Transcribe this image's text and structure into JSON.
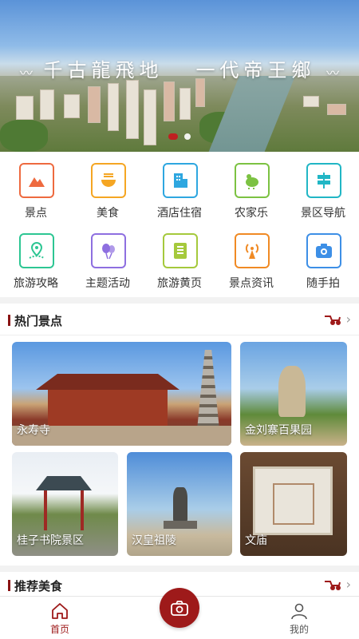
{
  "banner": {
    "title_left": "千古龍飛地",
    "title_right": "一代帝王鄉",
    "slide_count": 2,
    "active_slide": 0
  },
  "categories": [
    {
      "label": "景点",
      "icon": "mountain-icon",
      "color": "#ee6a3f"
    },
    {
      "label": "美食",
      "icon": "noodle-bowl-icon",
      "color": "#f5a623"
    },
    {
      "label": "酒店住宿",
      "icon": "hotel-building-icon",
      "color": "#2ea7e0"
    },
    {
      "label": "农家乐",
      "icon": "chicken-icon",
      "color": "#7cc242"
    },
    {
      "label": "景区导航",
      "icon": "signpost-icon",
      "color": "#21b6c5"
    },
    {
      "label": "旅游攻略",
      "icon": "map-pin-route-icon",
      "color": "#2dc693"
    },
    {
      "label": "主题活动",
      "icon": "balloons-icon",
      "color": "#8e6fe0"
    },
    {
      "label": "旅游黄页",
      "icon": "list-page-icon",
      "color": "#a5c93c"
    },
    {
      "label": "景点资讯",
      "icon": "broadcast-icon",
      "color": "#f08a24"
    },
    {
      "label": "随手拍",
      "icon": "camera-icon",
      "color": "#3d8fe6"
    }
  ],
  "hot_spots": {
    "title": "热门景点",
    "items": [
      {
        "label": "永寿寺"
      },
      {
        "label": "金刘寨百果园"
      },
      {
        "label": "桂子书院景区"
      },
      {
        "label": "汉皇祖陵"
      },
      {
        "label": "文庙"
      }
    ]
  },
  "food": {
    "title": "推荐美食"
  },
  "nav": {
    "home_label": "首页",
    "mine_label": "我的",
    "active_color": "#9e1a1a",
    "inactive_color": "#555555"
  },
  "colors": {
    "brand": "#9e1a1a"
  }
}
